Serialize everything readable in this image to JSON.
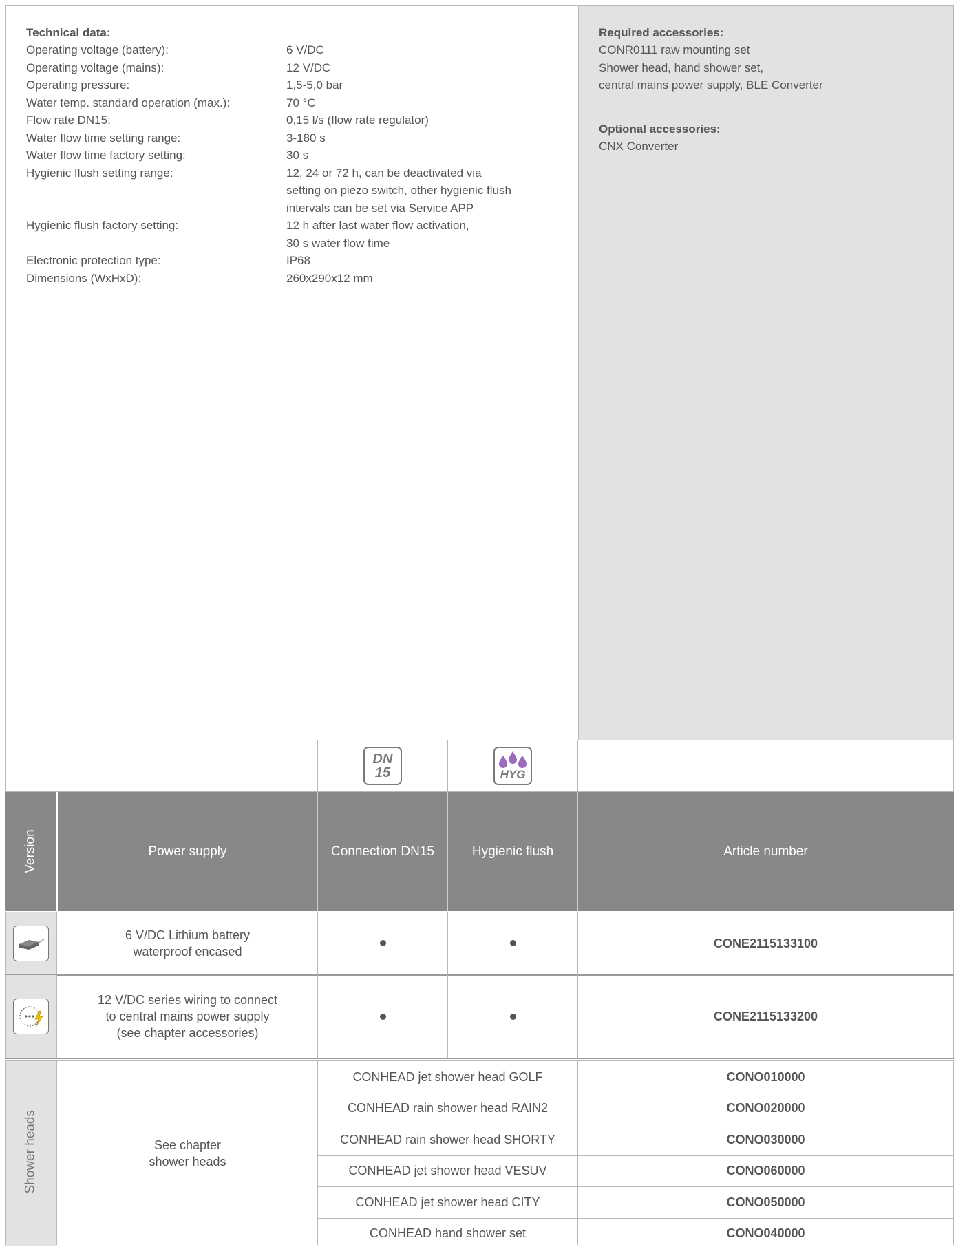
{
  "tech": {
    "title": "Technical data:",
    "rows": [
      {
        "label": "Operating voltage (battery):",
        "value": [
          "6 V/DC"
        ]
      },
      {
        "label": "Operating voltage (mains):",
        "value": [
          "12 V/DC"
        ]
      },
      {
        "label": "Operating pressure:",
        "value": [
          "1,5-5,0 bar"
        ]
      },
      {
        "label": "Water temp. standard operation (max.):",
        "value": [
          "70 °C"
        ]
      },
      {
        "label": "Flow rate DN15:",
        "value": [
          "0,15 l/s (flow rate regulator)"
        ]
      },
      {
        "label": "Water flow time setting range:",
        "value": [
          "3-180 s"
        ]
      },
      {
        "label": "Water flow time factory setting:",
        "value": [
          "30 s"
        ]
      },
      {
        "label": "Hygienic flush setting range:",
        "value": [
          "12, 24 or 72 h, can be deactivated via",
          "setting on piezo switch, other hygienic flush",
          "intervals can be set via Service APP"
        ]
      },
      {
        "label": "Hygienic flush factory setting:",
        "value": [
          "12 h after last water flow activation,",
          "30 s water flow time"
        ]
      },
      {
        "label": "Electronic protection type:",
        "value": [
          "IP68"
        ]
      },
      {
        "label": "Dimensions (WxHxD):",
        "value": [
          "260x290x12 mm"
        ]
      }
    ]
  },
  "accessories": {
    "required_title": "Required accessories:",
    "required_lines": [
      "CONR0111 raw mounting set",
      "Shower head, hand shower set,",
      "central mains power supply, BLE Converter"
    ],
    "optional_title": "Optional accessories:",
    "optional_lines": [
      "CNX Converter"
    ]
  },
  "icons": {
    "dn15_top": "DN",
    "dn15_bottom": "15",
    "hyg_label": "HYG",
    "hyg_color": "#9b6bbf"
  },
  "table": {
    "headers": {
      "version": "Version",
      "power": "Power supply",
      "connection": "Connection DN15",
      "hygienic": "Hygienic flush",
      "article": "Article number"
    },
    "rows": [
      {
        "icon": "battery-icon",
        "power": [
          "6 V/DC Lithium battery",
          "waterproof encased"
        ],
        "article": "CONE2115133100"
      },
      {
        "icon": "power-socket-icon",
        "power": [
          "12 V/DC series wiring to connect",
          "to central mains power supply",
          "(see chapter accessories)"
        ],
        "article": "CONE2115133200"
      }
    ]
  },
  "shower": {
    "side_label": "Shower heads",
    "see_chapter": [
      "See chapter",
      "shower heads"
    ],
    "items": [
      {
        "name": "CONHEAD jet shower head GOLF",
        "article": "CONO010000"
      },
      {
        "name": "CONHEAD rain shower head RAIN2",
        "article": "CONO020000"
      },
      {
        "name": "CONHEAD rain shower head SHORTY",
        "article": "CONO030000"
      },
      {
        "name": "CONHEAD jet shower head VESUV",
        "article": "CONO060000"
      },
      {
        "name": "CONHEAD jet shower head CITY",
        "article": "CONO050000"
      },
      {
        "name": "CONHEAD hand shower set",
        "article": "CONO040000"
      }
    ]
  },
  "colors": {
    "header_gray": "#888888",
    "panel_gray": "#e2e2e2",
    "border": "#b8b8b8"
  }
}
